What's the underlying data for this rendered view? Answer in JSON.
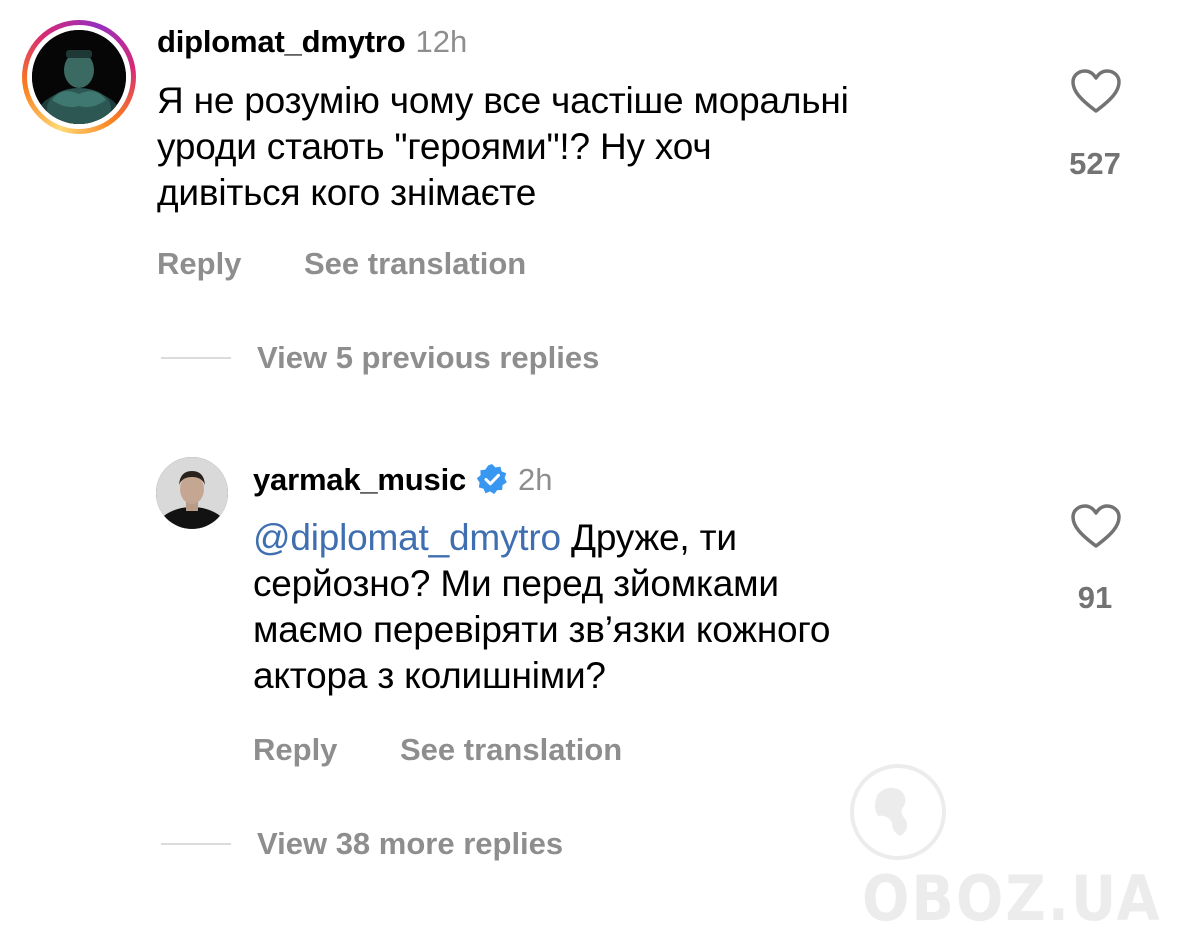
{
  "comments": [
    {
      "username": "diplomat_dmytro",
      "time": "12h",
      "text": "Я не розумію чому все частіше моральні уроди стають \"героями\"!? Ну хоч дивіться кого знімаєте",
      "lines": [
        "Я не розумію чому все частіше моральні",
        "уроди стають \"героями\"!? Ну хоч",
        "дивіться кого знімаєте"
      ],
      "likes": "527",
      "reply_label": "Reply",
      "translate_label": "See translation",
      "avatar_icon": "user-avatar-story-ring"
    },
    {
      "username": "yarmak_music",
      "verified": true,
      "time": "2h",
      "mention": "@diplomat_dmytro",
      "lines_rest": [
        " Друже, ти",
        "серйозно? Ми перед зйомками",
        "маємо перевіряти зв’язки кожного",
        "актора з колишніми?"
      ],
      "likes": "91",
      "reply_label": "Reply",
      "translate_label": "See translation",
      "avatar_icon": "user-avatar"
    }
  ],
  "view_previous_replies": "View 5 previous replies",
  "view_more_replies": "View 38 more replies",
  "watermark": "OBOZ.UA",
  "colors": {
    "secondary_text": "#8e8e8e",
    "mention": "#3f6fb0",
    "verified": "#3897f0",
    "divider": "#dbdbdb"
  },
  "icons": [
    "heart-icon",
    "verified-badge-icon",
    "globe-icon"
  ]
}
